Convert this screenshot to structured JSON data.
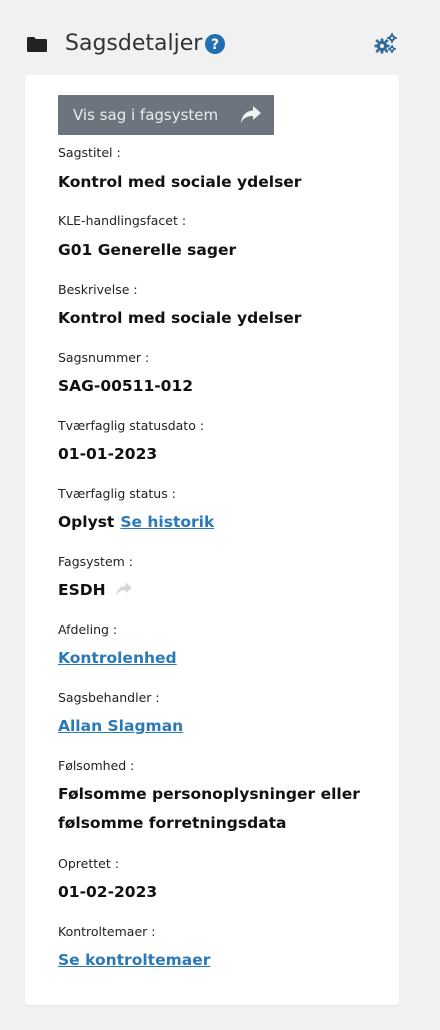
{
  "header": {
    "title": "Sagsdetaljer",
    "folder_icon": "folder-icon",
    "help_icon": "help-circle-icon",
    "settings_icon": "gears-icon"
  },
  "actions": {
    "vis_sag_label": "Vis sag i fagsystem",
    "vis_sag_icon": "share-arrow-icon"
  },
  "fields": {
    "sagstitel": {
      "label": "Sagstitel :",
      "value": "Kontrol med sociale ydelser"
    },
    "kle": {
      "label": "KLE-handlingsfacet :",
      "value": "G01 Generelle sager"
    },
    "beskrivelse": {
      "label": "Beskrivelse :",
      "value": "Kontrol med sociale ydelser"
    },
    "sagsnummer": {
      "label": "Sagsnummer :",
      "value": "SAG-00511-012"
    },
    "statusdato": {
      "label": "Tværfaglig statusdato :",
      "value": "01-01-2023"
    },
    "status": {
      "label": "Tværfaglig status :",
      "value": "Oplyst",
      "link": "Se historik"
    },
    "fagsystem": {
      "label": "Fagsystem :",
      "value": "ESDH",
      "icon": "share-arrow-icon"
    },
    "afdeling": {
      "label": "Afdeling :",
      "link": "Kontrolenhed"
    },
    "sagsbehandler": {
      "label": "Sagsbehandler :",
      "link": "Allan Slagman"
    },
    "folsomhed": {
      "label": "Følsomhed :",
      "value_line1": "Følsomme personoplysninger eller",
      "value_line2": "følsomme forretningsdata"
    },
    "oprettet": {
      "label": "Oprettet :",
      "value": "01-02-2023"
    },
    "kontroltemaer": {
      "label": "Kontroltemaer :",
      "link": "Se kontroltemaer"
    }
  },
  "colors": {
    "page_bg": "#f1f1f1",
    "card_bg": "#ffffff",
    "button_bg": "#6c757d",
    "link": "#2a7ab8",
    "help_icon": "#1f6fb2",
    "gear_icon": "#2f6b9a"
  }
}
